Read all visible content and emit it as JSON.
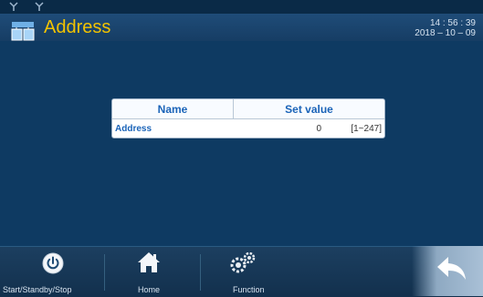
{
  "header": {
    "title": "Address",
    "time": "14 : 56 : 39",
    "date": "2018 – 10 – 09"
  },
  "table": {
    "headers": {
      "name": "Name",
      "set_value": "Set value"
    },
    "rows": [
      {
        "name": "Address",
        "value": "0",
        "range": "[1~247]"
      }
    ]
  },
  "nav": {
    "start": "Start/Standby/Stop",
    "home": "Home",
    "function": "Function"
  },
  "icons": [
    "antenna-icon",
    "address-icon",
    "power-icon",
    "home-icon",
    "gears-icon",
    "back-arrow-icon"
  ],
  "colors": {
    "title": "#f2c300",
    "background": "#0e3a62",
    "accent": "#1a63b8"
  }
}
